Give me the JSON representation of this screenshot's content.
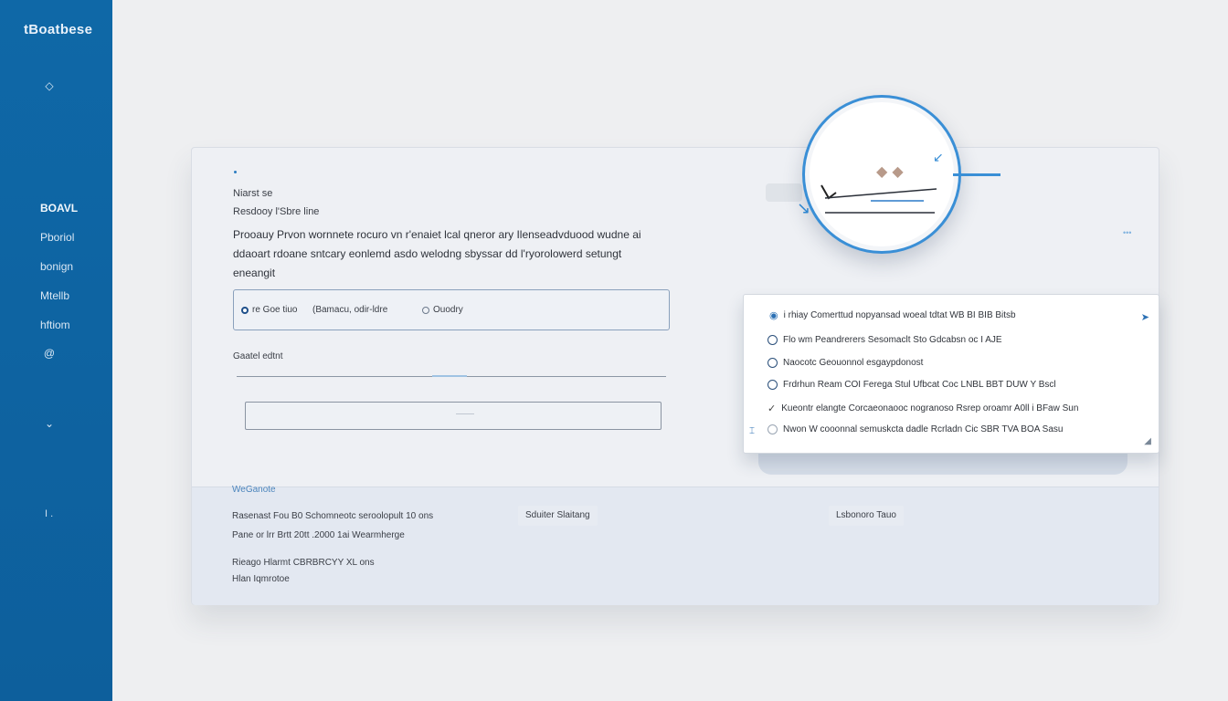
{
  "sidebar": {
    "logo": "tBoatbese",
    "section": "BOAVL",
    "items": [
      {
        "label": "Pboriol"
      },
      {
        "label": "bonign"
      },
      {
        "label": "Mtellb"
      },
      {
        "label": "hftiom"
      }
    ],
    "footer_text": "I ."
  },
  "form": {
    "title_line_1": "Niarst se",
    "title_line_2": "Resdooy l'Sbre line",
    "paragraph": "Prooauy Prvon wornnete rocuro vn r'enaiet lcal qneror ary Ilenseadvduood wudne ai ddaoart rdoane sntcary eonlemd asdo welodng sbyssar dd l'ryorolowerd setungt eneangit",
    "radio_options": [
      {
        "label": "re Goe tiuo",
        "selected": true
      },
      {
        "label": "(Bamacu, odir-ldre",
        "selected": false
      },
      {
        "label": "Ouodry",
        "selected": false
      }
    ],
    "field_label": "Gaatel edtnt",
    "text_input_value": "",
    "box_input_value": ""
  },
  "bottom": {
    "title": "WeGanote",
    "rows": [
      {
        "text": "Rasenast    Fou  B0  Schomneotc seroolopult 10 ons"
      },
      {
        "text": "Pane or lrr  Brtt  20tt  .2000  1ai Wearmherge"
      },
      {
        "text": "Rieago  Hlarmt   CBRBRCYY XL ons"
      },
      {
        "text": "Hlan Iqmrotoe"
      }
    ],
    "pill_middle": "Sduiter Slaitang",
    "pill_right": "Lsbonoro Tauo"
  },
  "panel": {
    "header": "i  rhiay  Comerttud  nopyansad  woeal  tdtat  WB  BI  BIB  Bitsb",
    "items": [
      {
        "label": "Flo  wm  Peandrerers  Sesomaclt Sto  Gdcabsn  oc  I  AJE"
      },
      {
        "label": "Naocotc  Geouonnol  esgaypdonost"
      },
      {
        "label": "Frdrhun  Ream  COI  Ferega  Stul  Ufbcat  Coc  LNBL  BBT  DUW  Y  Bscl"
      },
      {
        "label": "Kueontr  elangte  Corcaeonaooc  nogranoso  Rsrep  oroamr  A0ll  i  BFaw  Sun"
      },
      {
        "label": "Nwon  W  cooonnal  semuskcta  dadle  Rcrladn  Cic  SBR  TVA  BOA  Sasu"
      }
    ]
  },
  "colors": {
    "sidebar": "#0f68a7",
    "accent": "#3a8fd6",
    "card": "#eef0f4"
  },
  "icons": {
    "sidebar_top": "diamond-icon",
    "sidebar_mid": "at-sign-icon",
    "sidebar_low": "chevron-down-icon",
    "panel_header": "camera-icon",
    "panel_corner": "send-icon"
  }
}
